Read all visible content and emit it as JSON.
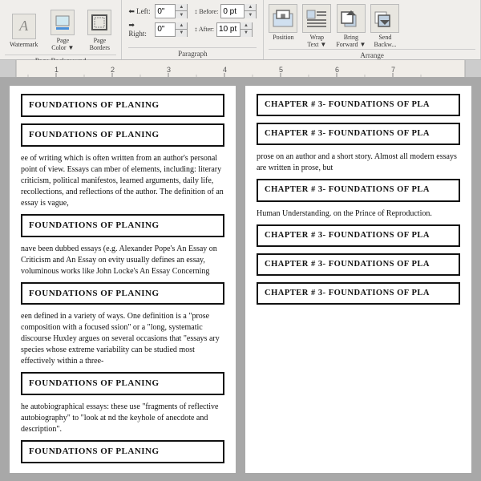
{
  "toolbar": {
    "sections": {
      "page_background": {
        "label": "Page Background",
        "controls": [
          {
            "id": "left",
            "label": "Left:",
            "value": "0\""
          },
          {
            "id": "right",
            "label": "Right:",
            "value": "0\""
          }
        ]
      },
      "spacing": {
        "before_label": "Before:",
        "before_value": "0 pt",
        "after_label": "After:",
        "after_value": "10 pt"
      },
      "paragraph_label": "Paragraph",
      "arrange": {
        "label": "Arrange",
        "items": [
          {
            "name": "Position",
            "label": "Position"
          },
          {
            "name": "Wrap Text",
            "label": "Wrap\nText▼"
          },
          {
            "name": "Bring Forward",
            "label": "Bring\nForward▼"
          },
          {
            "name": "Send Backward",
            "label": "Send\nBackw..."
          }
        ]
      }
    }
  },
  "ruler": {
    "marks": [
      "1",
      "2",
      "3",
      "4",
      "5",
      "6",
      "7"
    ]
  },
  "document": {
    "left_page": {
      "sections": [
        {
          "heading": "FOUNDATIONS OF PLANING",
          "body": ""
        },
        {
          "heading": "FOUNDATIONS OF PLANING",
          "body": "ee of writing which is often written from an author's personal point of view. Essays can mber of elements, including: literary criticism,  political manifestos, learned arguments, daily life, recollections, and reflections of the author. The definition of an essay is vague,"
        },
        {
          "heading": "FOUNDATIONS OF PLANING",
          "body": "nave been dubbed essays (e.g. Alexander Pope's An Essay on Criticism and An Essay on evity usually defines an essay, voluminous works like John Locke's An Essay Concerning"
        },
        {
          "heading": "FOUNDATIONS OF PLANING",
          "body": "een defined in a variety of ways. One definition is a \"prose composition with a focused ssion\" or a \"long, systematic discourse Huxley argues on several occasions that \"essays ary species whose extreme variability can be studied most effectively within a three-"
        },
        {
          "heading": "FOUNDATIONS OF PLANING",
          "body": "he autobiographical essays: these use \"fragments of reflective autobiography\" to \"look at nd the keyhole of anecdote and description\"."
        },
        {
          "heading": "FOUNDATIONS OF PLANING",
          "body": ""
        }
      ]
    },
    "right_page": {
      "sections": [
        {
          "heading": "CHAPTER # 3- FOUNDATIONS OF PLA",
          "body": ""
        },
        {
          "heading": "CHAPTER # 3- FOUNDATIONS OF PLA",
          "body": "prose on an author and a short story. Almost all modern essays are written in prose, but"
        },
        {
          "heading": "CHAPTER # 3- FOUNDATIONS OF PLA",
          "body": "Human Understanding.                                      on the Prince of Reproduction."
        },
        {
          "heading": "CHAPTER # 3- FOUNDATIONS OF PLA",
          "body": ""
        },
        {
          "heading": "CHAPTER # 3- FOUNDATIONS OF PLA",
          "body": ""
        },
        {
          "heading": "CHAPTER # 3- FOUNDATIONS OF PLA",
          "body": ""
        }
      ]
    }
  }
}
